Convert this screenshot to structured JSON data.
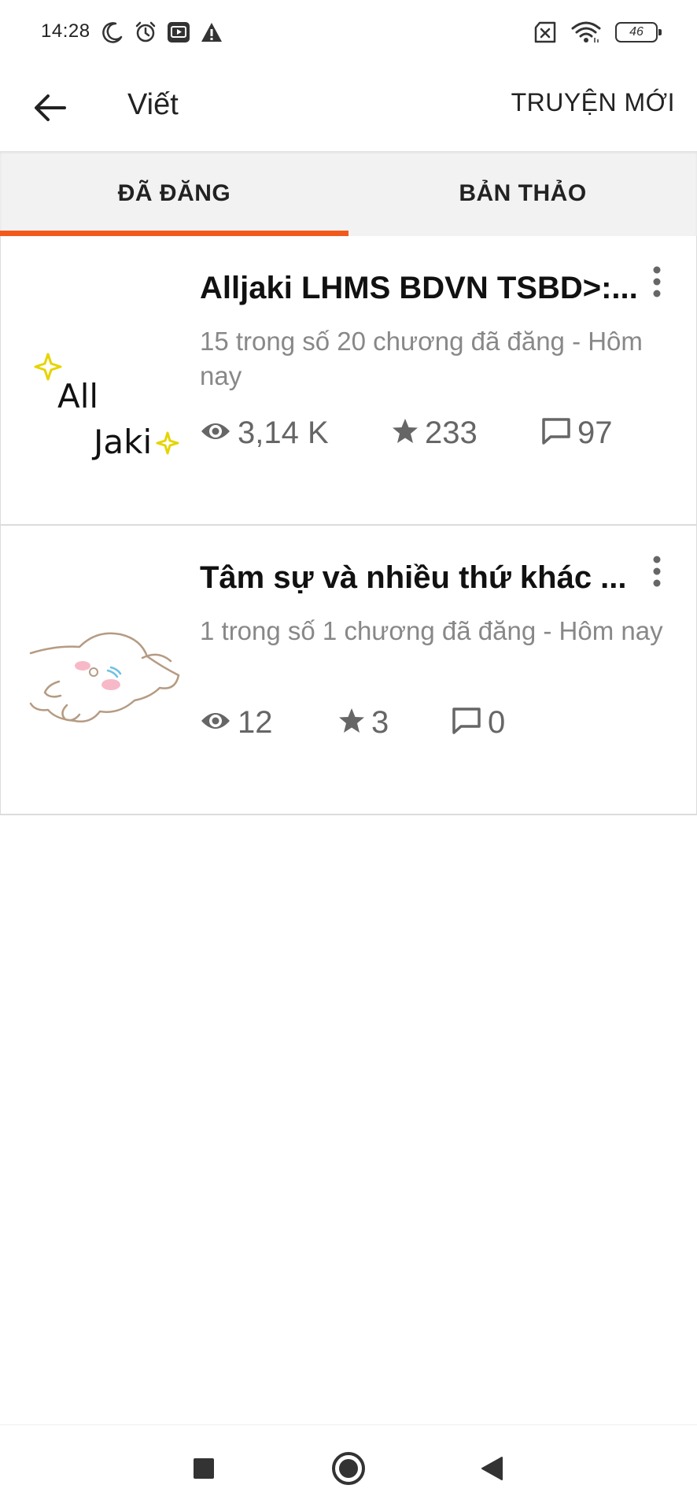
{
  "status_bar": {
    "time": "14:28",
    "battery_level": "46",
    "icons_left": [
      "moon-icon",
      "alarm-icon",
      "cast-app-icon",
      "warning-icon"
    ],
    "icons_right": [
      "no-sim-icon",
      "wifi-icon",
      "battery-icon"
    ]
  },
  "app_bar": {
    "title": "Viết",
    "new_story_label": "TRUYỆN MỚI"
  },
  "tabs": [
    {
      "label": "ĐÃ ĐĂNG",
      "selected": true
    },
    {
      "label": "BẢN THẢO",
      "selected": false
    }
  ],
  "colors": {
    "accent": "#f25a1c",
    "text_primary": "#111111",
    "text_secondary": "#888888",
    "stat_gray": "#666666"
  },
  "stories": [
    {
      "title": "Alljaki LHMS BDVN TSBD>:...",
      "chapters_line": "15 trong số 20 chương đã đăng - Hôm nay",
      "cover_text_line1": "All",
      "cover_text_line2": "Jaki",
      "views": "3,14 K",
      "votes": "233",
      "comments": "97"
    },
    {
      "title": "Tâm sự và nhiều thứ khác ...",
      "chapters_line": "1 trong số 1 chương đã đăng - Hôm nay",
      "views": "12",
      "votes": "3",
      "comments": "0"
    }
  ]
}
